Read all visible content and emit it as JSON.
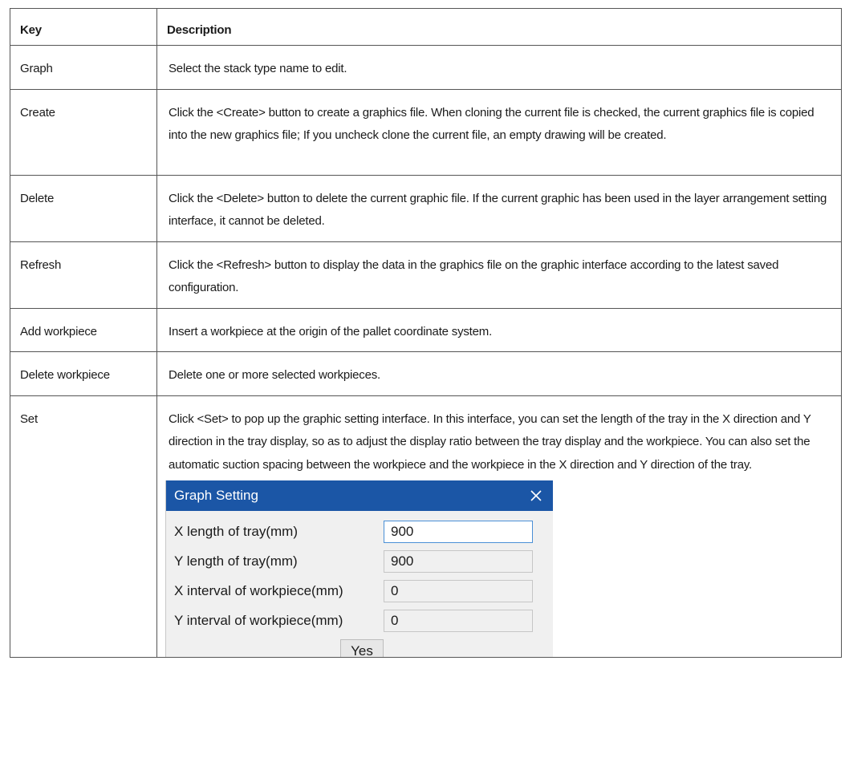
{
  "table": {
    "header": {
      "key": "Key",
      "description": "Description"
    },
    "rows": [
      {
        "key": "Graph",
        "description": "Select the stack type name to edit."
      },
      {
        "key": "Create",
        "description": "Click the <Create> button to create a graphics file. When cloning the current file is checked, the current graphics file is copied into the new graphics file; If you uncheck clone the current file, an empty drawing will be created."
      },
      {
        "key": "Delete",
        "description": "Click the <Delete> button to delete the current graphic file. If the current graphic has been used in the layer arrangement setting interface, it cannot be deleted."
      },
      {
        "key": "Refresh",
        "description": "Click the <Refresh> button to display the data in the graphics file on the graphic interface according to the latest saved configuration."
      },
      {
        "key": "Add workpiece",
        "description": "Insert a workpiece at the origin of the pallet coordinate system."
      },
      {
        "key": "Delete workpiece",
        "description": "Delete one or more selected workpieces."
      },
      {
        "key": "Set",
        "description": "Click <Set> to pop up the graphic setting interface. In this interface, you can set the length of the tray in the X direction and Y direction in the tray display, so as to adjust the display ratio between the tray display and the workpiece. You can also set the automatic suction spacing between the workpiece and the workpiece in the X direction and Y direction of the tray."
      }
    ]
  },
  "dialog": {
    "title": "Graph Setting",
    "close_icon": "close-icon",
    "fields": [
      {
        "label": "X length of tray(mm)",
        "value": "900"
      },
      {
        "label": "Y length of tray(mm)",
        "value": "900"
      },
      {
        "label": "X interval of workpiece(mm)",
        "value": "0"
      },
      {
        "label": "Y interval of workpiece(mm)",
        "value": "0"
      }
    ],
    "confirm_label": "Yes",
    "colors": {
      "title_bar": "#1b56a6",
      "body": "#f0f0f0",
      "focus_border": "#4a8fd6"
    }
  }
}
